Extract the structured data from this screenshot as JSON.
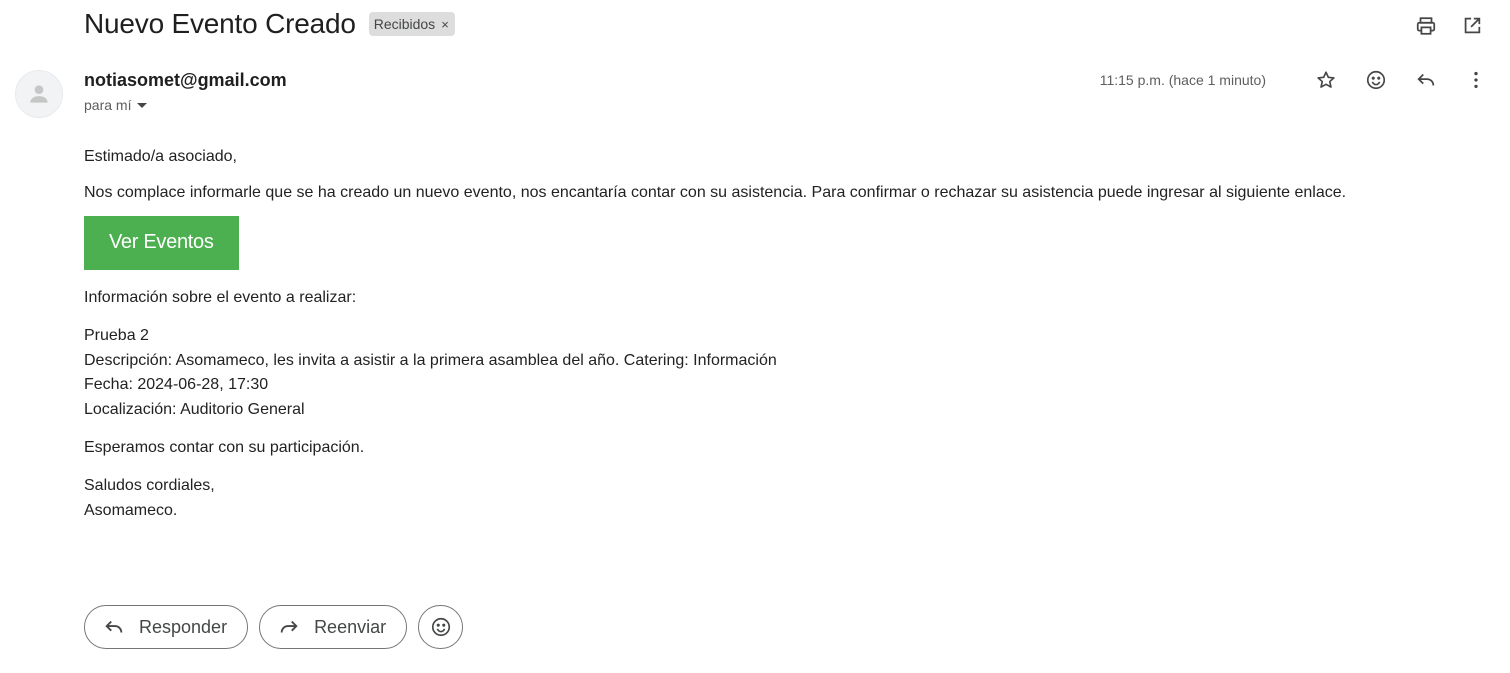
{
  "email": {
    "subject": "Nuevo Evento Creado",
    "label": "Recibidos",
    "label_remove": "×",
    "sender": "notiasomet@gmail.com",
    "recipient": "para mí",
    "timestamp": "11:15 p.m. (hace 1 minuto)"
  },
  "body": {
    "greeting": "Estimado/a asociado,",
    "intro": "Nos complace informarle que se ha creado un nuevo evento, nos encantaría contar con su asistencia. Para confirmar o rechazar su asistencia puede ingresar al siguiente enlace.",
    "cta_label": "Ver Eventos",
    "info_heading": "Información sobre el evento a realizar:",
    "event_name": "Prueba 2",
    "event_description": "Descripción: Asomameco, les invita a asistir a la primera asamblea del año. Catering: Información",
    "event_date": "Fecha: 2024-06-28, 17:30",
    "event_location": "Localización: Auditorio General",
    "closing": "Esperamos contar con su participación.",
    "signoff": "Saludos cordiales,",
    "signature": "Asomameco."
  },
  "actions": {
    "reply_label": "Responder",
    "forward_label": "Reenviar"
  },
  "icons": {
    "top": [
      "print-icon",
      "open-in-new-window-icon"
    ],
    "header": [
      "star-icon",
      "emoji-icon",
      "reply-icon",
      "more-vert-icon"
    ],
    "bottom": [
      "reply-icon",
      "forward-icon",
      "emoji-icon"
    ]
  },
  "colors": {
    "cta_background": "#4caf50",
    "label_chip": "#dddddd"
  }
}
